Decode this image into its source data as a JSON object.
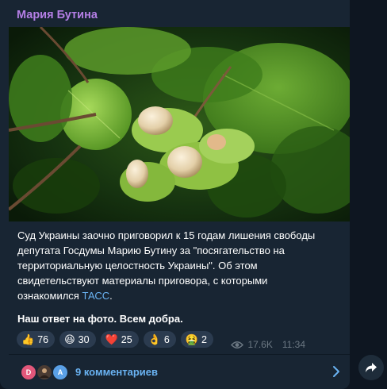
{
  "post": {
    "author": "Мария Бутина",
    "text_line1": "Суд Украины заочно приговорил к 15 годам лишения свободы",
    "text_line2": "депутата Госдумы Марию Бутину за \"посягательство на",
    "text_line3": "территориальную целостность Украины\". Об этом",
    "text_line4": "свидетельствуют материалы приговора, с которыми",
    "text_line5_prefix": "ознакомился ",
    "text_link": "ТАСС",
    "text_line5_suffix": ".",
    "bold_text": "Наш ответ на фото. Всем добра."
  },
  "reactions": [
    {
      "emoji": "👍",
      "count": "76"
    },
    {
      "emoji": "😆",
      "count": "30"
    },
    {
      "emoji": "❤️",
      "count": "25"
    },
    {
      "emoji": "👌",
      "count": "6"
    },
    {
      "emoji": "🤮",
      "count": "2"
    }
  ],
  "meta": {
    "views": "17.6K",
    "time": "11:34",
    "icon": "eye-icon"
  },
  "comments": {
    "label": "9 комментариев",
    "avatars": [
      {
        "letter": "D",
        "color": "#e2577a"
      },
      {
        "letter": "",
        "color": "#4a3b33"
      },
      {
        "letter": "A",
        "color": "#5aa0e6"
      }
    ]
  },
  "colors": {
    "background": "#0e1621",
    "bubble": "#182533",
    "author": "#b57fe6",
    "link": "#6ab3f3",
    "meta": "#6c7883",
    "reaction_bg": "#2b3b4f"
  }
}
